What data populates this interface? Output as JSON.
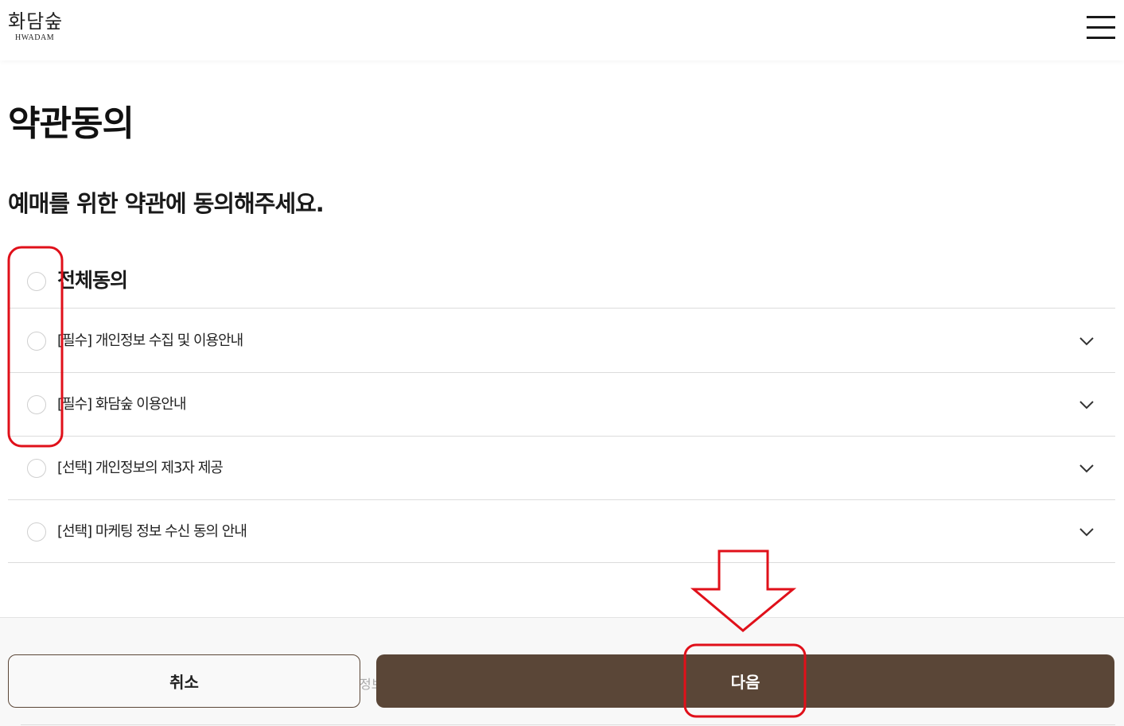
{
  "header": {
    "logo_ko": "화담숲",
    "logo_en": "HWADAM",
    "menu_icon": "hamburger-menu-icon"
  },
  "page": {
    "title": "약관동의",
    "subtitle": "예매를 위한 약관에 동의해주세요."
  },
  "agreements": {
    "all_label": "전체동의",
    "items": [
      {
        "label": "[필수] 개인정보 수집 및 이용안내"
      },
      {
        "label": "[필수] 화담숲 이용안내"
      },
      {
        "label": "[선택] 개인정보의 제3자 제공"
      },
      {
        "label": "[선택] 마케팅 정보 수신 동의 안내"
      }
    ]
  },
  "actions": {
    "cancel_label": "취소",
    "next_label": "다음",
    "peek_text": "정보"
  },
  "colors": {
    "brand_brown": "#5a4637",
    "annotation_red": "#e0101a"
  }
}
